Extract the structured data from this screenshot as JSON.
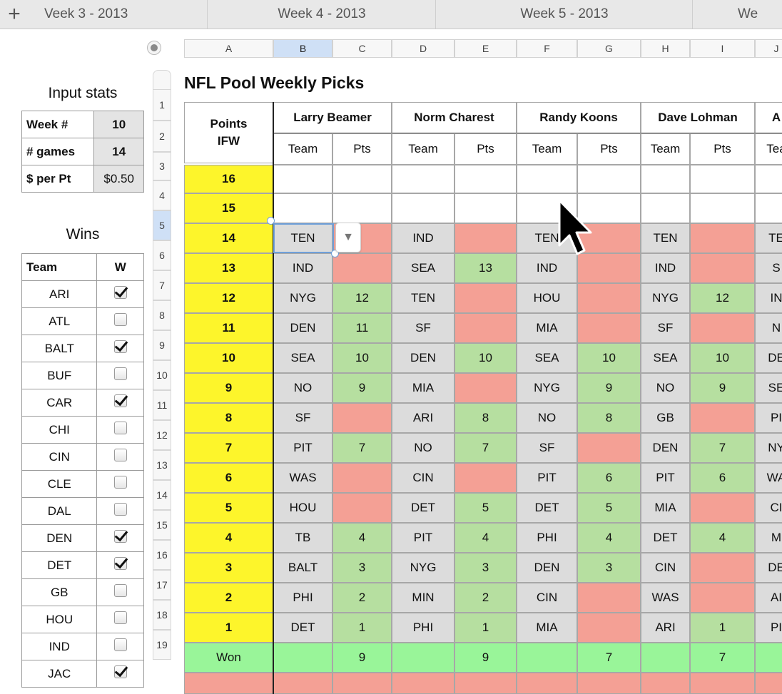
{
  "tabs": [
    "Veek 3 - 2013",
    "Week 4 - 2013",
    "Week 5 - 2013",
    "We"
  ],
  "add_sheet_icon": "plus-icon",
  "columns": [
    "A",
    "B",
    "C",
    "D",
    "E",
    "F",
    "G",
    "H",
    "I",
    "J"
  ],
  "rows": [
    "1",
    "2",
    "3",
    "4",
    "5",
    "6",
    "7",
    "8",
    "9",
    "10",
    "11",
    "12",
    "13",
    "14",
    "15",
    "16",
    "17",
    "18",
    "19"
  ],
  "input_stats": {
    "title": "Input stats",
    "rows": [
      {
        "label": "Week #",
        "value": "10"
      },
      {
        "label": "# games",
        "value": "14"
      },
      {
        "label": "$ per Pt",
        "value": "$0.50"
      }
    ]
  },
  "wins": {
    "title": "Wins",
    "header": {
      "team": "Team",
      "w": "W"
    },
    "rows": [
      {
        "team": "ARI",
        "checked": true
      },
      {
        "team": "ATL",
        "checked": false
      },
      {
        "team": "BALT",
        "checked": true
      },
      {
        "team": "BUF",
        "checked": false
      },
      {
        "team": "CAR",
        "checked": true
      },
      {
        "team": "CHI",
        "checked": false
      },
      {
        "team": "CIN",
        "checked": false
      },
      {
        "team": "CLE",
        "checked": false
      },
      {
        "team": "DAL",
        "checked": false
      },
      {
        "team": "DEN",
        "checked": true
      },
      {
        "team": "DET",
        "checked": true
      },
      {
        "team": "GB",
        "checked": false
      },
      {
        "team": "HOU",
        "checked": false
      },
      {
        "team": "IND",
        "checked": false
      },
      {
        "team": "JAC",
        "checked": true
      }
    ]
  },
  "picks": {
    "title": "NFL Pool Weekly Picks",
    "points_header": [
      "Points",
      "IFW"
    ],
    "players": [
      "Larry Beamer",
      "Norm Charest",
      "Randy Koons",
      "Dave Lohman",
      "A"
    ],
    "sub_headers": [
      "Team",
      "Pts",
      "Team",
      "Pts",
      "Team",
      "Pts",
      "Team",
      "Pts",
      "Tea"
    ],
    "rows": [
      {
        "points": "16",
        "cells": [
          "",
          "",
          "",
          "",
          "",
          "",
          "",
          "",
          ""
        ]
      },
      {
        "points": "15",
        "cells": [
          "",
          "",
          "",
          "",
          "",
          "",
          "",
          "",
          ""
        ]
      },
      {
        "points": "14",
        "cells": [
          "TEN",
          "",
          "IND",
          "",
          "TEN",
          "",
          "TEN",
          "",
          "TE"
        ]
      },
      {
        "points": "13",
        "cells": [
          "IND",
          "",
          "SEA",
          "13",
          "IND",
          "",
          "IND",
          "",
          "S"
        ]
      },
      {
        "points": "12",
        "cells": [
          "NYG",
          "12",
          "TEN",
          "",
          "HOU",
          "",
          "NYG",
          "12",
          "IN"
        ]
      },
      {
        "points": "11",
        "cells": [
          "DEN",
          "11",
          "SF",
          "",
          "MIA",
          "",
          "SF",
          "",
          "N"
        ]
      },
      {
        "points": "10",
        "cells": [
          "SEA",
          "10",
          "DEN",
          "10",
          "SEA",
          "10",
          "SEA",
          "10",
          "DE"
        ]
      },
      {
        "points": "9",
        "cells": [
          "NO",
          "9",
          "MIA",
          "",
          "NYG",
          "9",
          "NO",
          "9",
          "SE"
        ]
      },
      {
        "points": "8",
        "cells": [
          "SF",
          "",
          "ARI",
          "8",
          "NO",
          "8",
          "GB",
          "",
          "PI"
        ]
      },
      {
        "points": "7",
        "cells": [
          "PIT",
          "7",
          "NO",
          "7",
          "SF",
          "",
          "DEN",
          "7",
          "NY"
        ]
      },
      {
        "points": "6",
        "cells": [
          "WAS",
          "",
          "CIN",
          "",
          "PIT",
          "6",
          "PIT",
          "6",
          "WA"
        ]
      },
      {
        "points": "5",
        "cells": [
          "HOU",
          "",
          "DET",
          "5",
          "DET",
          "5",
          "MIA",
          "",
          "CI"
        ]
      },
      {
        "points": "4",
        "cells": [
          "TB",
          "4",
          "PIT",
          "4",
          "PHI",
          "4",
          "DET",
          "4",
          "M"
        ]
      },
      {
        "points": "3",
        "cells": [
          "BALT",
          "3",
          "NYG",
          "3",
          "DEN",
          "3",
          "CIN",
          "",
          "DE"
        ]
      },
      {
        "points": "2",
        "cells": [
          "PHI",
          "2",
          "MIN",
          "2",
          "CIN",
          "",
          "WAS",
          "",
          "AI"
        ]
      },
      {
        "points": "1",
        "cells": [
          "DET",
          "1",
          "PHI",
          "1",
          "MIA",
          "",
          "ARI",
          "1",
          "PI"
        ]
      }
    ],
    "won_row": {
      "label": "Won",
      "cells": [
        "",
        "9",
        "",
        "9",
        "",
        "7",
        "",
        "7",
        ""
      ]
    }
  },
  "colors": {
    "points_yellow": "#fdf52b",
    "team_gray": "#dcdcdc",
    "win_green": "#b6dfa0",
    "loss_red": "#f4a095",
    "won_row_green": "#99f599",
    "selection_blue": "#6f9fd8"
  },
  "dropdown_icon": "triangle-down-icon",
  "cursor_icon": "mouse-pointer-icon"
}
